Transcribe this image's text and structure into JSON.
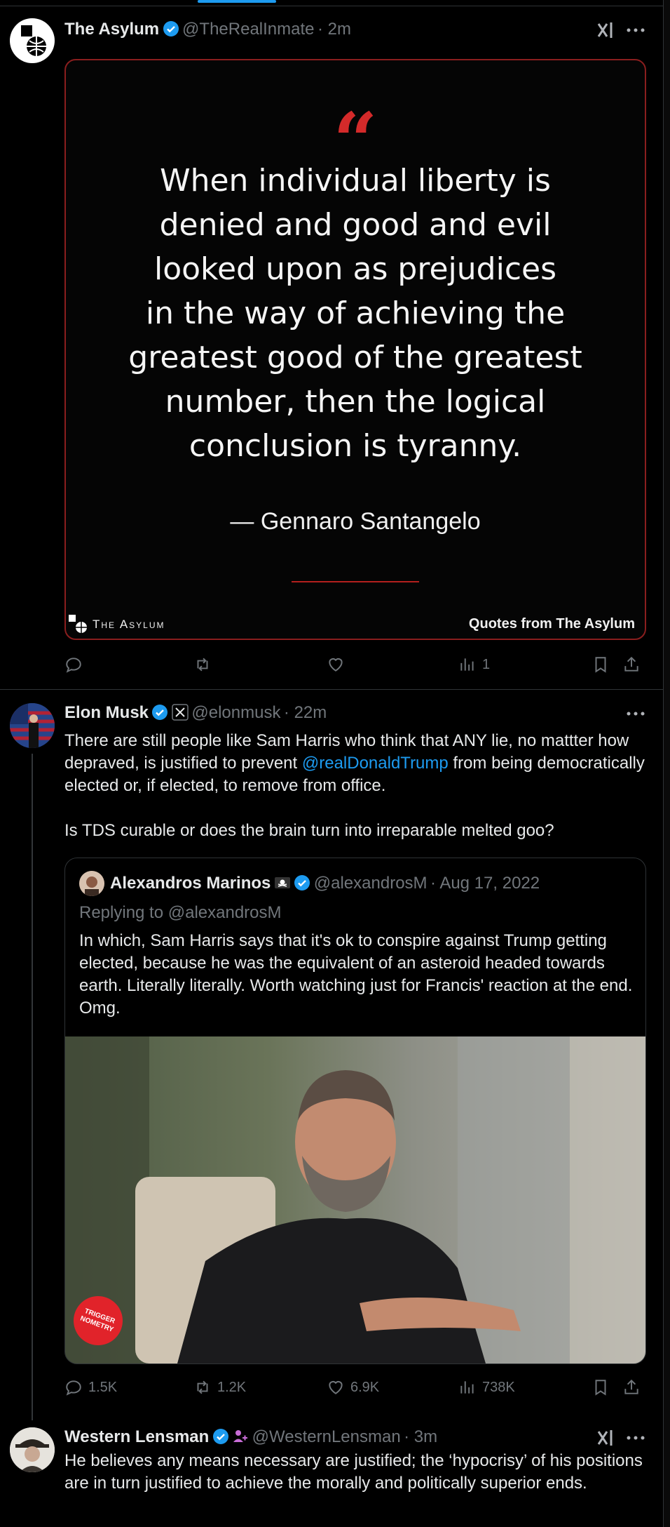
{
  "tweets": [
    {
      "name": "The Asylum",
      "handle": "@TheRealInmate",
      "time": "· 2m",
      "image": {
        "quote_mark": "“",
        "quote": "When individual liberty is denied and good and evil looked upon as prejudices in the way of achieving the greatest good of the greatest number, then the logical conclusion is tyranny.",
        "quote_lines": [
          "When individual liberty is",
          "denied and good and evil",
          "looked upon as prejudices",
          "in the way of achieving the",
          "greatest good of the greatest",
          "number, then the logical",
          "conclusion is tyranny."
        ],
        "author": "— Gennaro Santangelo",
        "brand": "The Asylum",
        "footer": "Quotes from The Asylum"
      },
      "actions": {
        "replies": "",
        "reposts": "",
        "likes": "",
        "views": "1"
      }
    },
    {
      "name": "Elon Musk",
      "handle": "@elonmusk",
      "time": "· 22m",
      "text_before": "There are still people like Sam Harris who think that ANY lie, no mattter how depraved, is justified to prevent ",
      "mention": "@realDonaldTrump",
      "text_after": " from being democratically elected or, if elected, to remove from office.",
      "text_2": "Is TDS curable or does the brain turn into irreparable melted goo?",
      "quoted": {
        "name": "Alexandros Marinos",
        "handle": "@alexandrosM",
        "time": "· Aug 17, 2022",
        "replying": "Replying to @alexandrosM",
        "text": "In which, Sam Harris says that it's ok to conspire against Trump getting elected, because he was the equivalent of an asteroid headed towards earth. Literally literally. Worth watching just for Francis' reaction at the end. Omg.",
        "badge": "TRIGGER NOMETRY"
      },
      "actions": {
        "replies": "1.5K",
        "reposts": "1.2K",
        "likes": "6.9K",
        "views": "738K"
      }
    },
    {
      "name": "Western Lensman",
      "handle": "@WesternLensman",
      "time": "· 3m",
      "text": "He believes any means necessary are justified; the ‘hypocrisy’ of his positions are in turn justified to achieve the morally and politically superior ends."
    }
  ],
  "colors": {
    "accent": "#1d9bf0",
    "muted": "#71767b",
    "quote_border": "#8a1e1e",
    "quote_mark": "#d42a2a"
  }
}
